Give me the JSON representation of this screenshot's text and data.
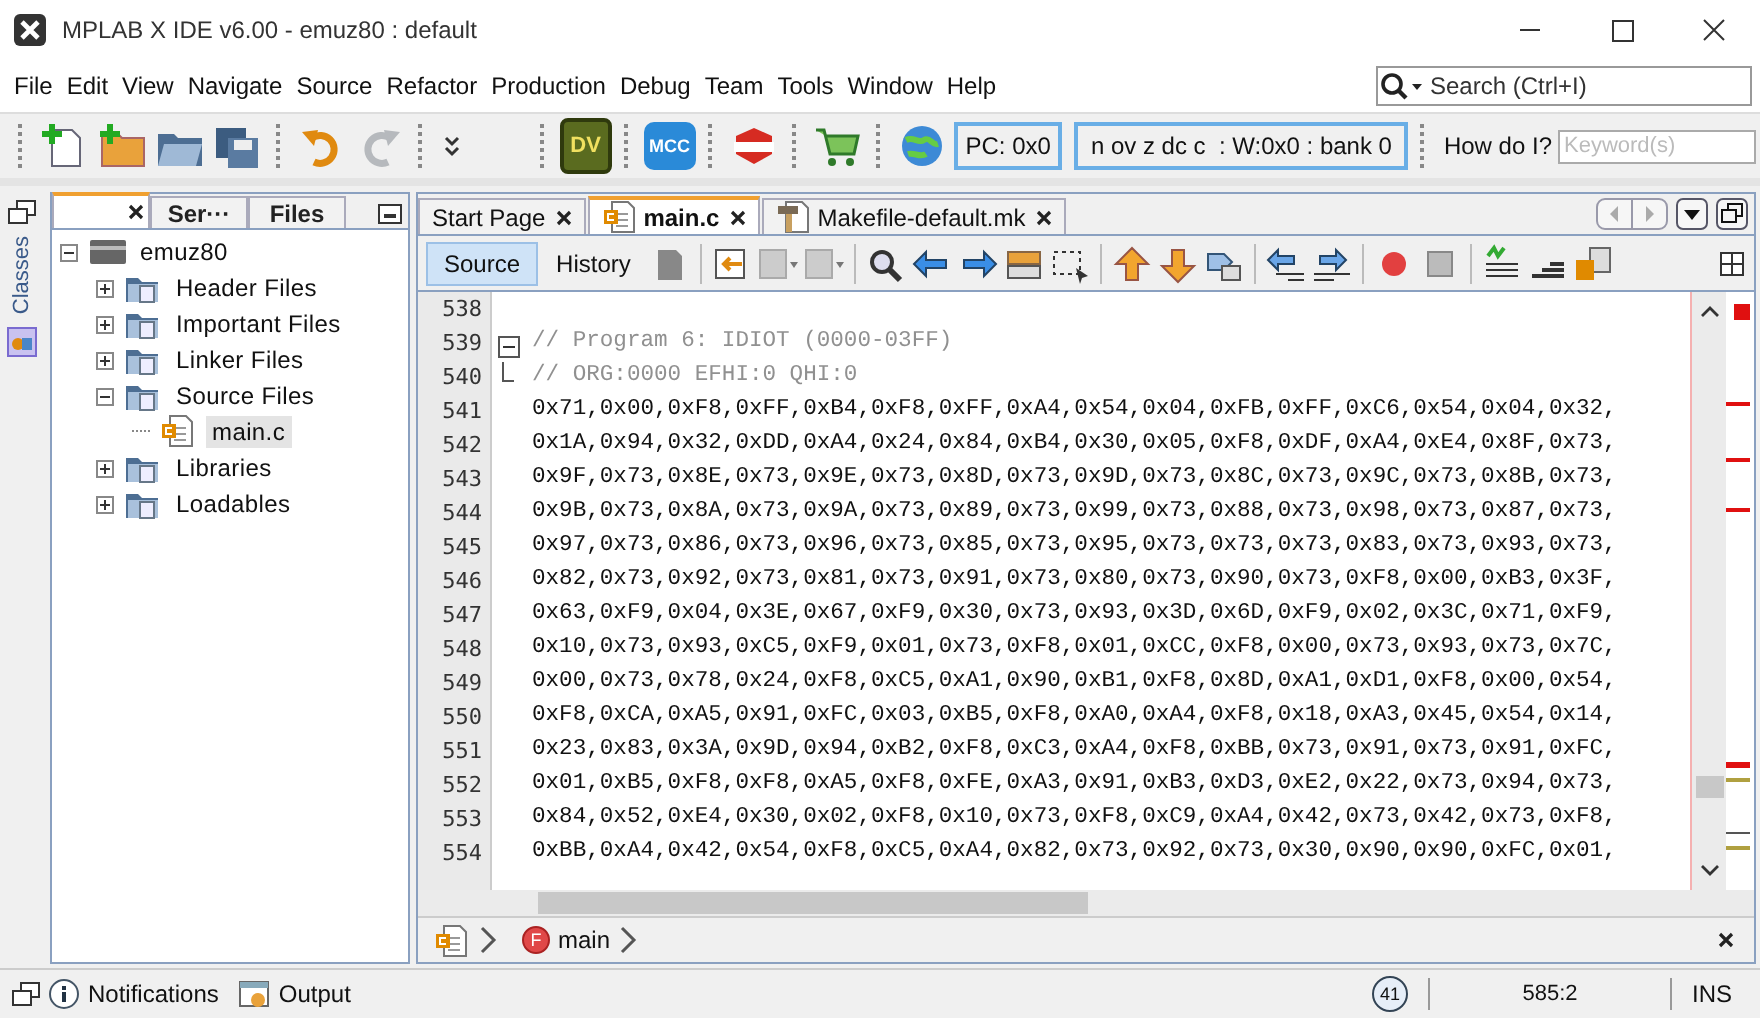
{
  "window": {
    "title": "MPLAB X IDE v6.00 - emuz80 : default"
  },
  "menu": [
    "File",
    "Edit",
    "View",
    "Navigate",
    "Source",
    "Refactor",
    "Production",
    "Debug",
    "Team",
    "Tools",
    "Window",
    "Help"
  ],
  "search": {
    "placeholder": "Search (Ctrl+I)"
  },
  "toolbar": {
    "logos": [
      {
        "kind": "dv",
        "label": "DV"
      },
      {
        "kind": "mcc",
        "label": "MCC"
      }
    ],
    "pc": "PC: 0x0",
    "status": "n ov z dc c  : W:0x0 : bank 0",
    "help_label": "How do I?",
    "keyword": {
      "placeholder": "Keyword(s)"
    }
  },
  "side_strip": {
    "label": "Classes"
  },
  "left_panel": {
    "tabs": [
      {
        "selected": true
      },
      {
        "label": "Ser···",
        "selected": false
      },
      {
        "label": "Files",
        "selected": false
      }
    ],
    "tree": [
      {
        "label": "emuz80",
        "kind": "project",
        "expanded": true,
        "selected": false,
        "children": [
          {
            "label": "Header Files",
            "kind": "folder",
            "expanded": false,
            "selected": false
          },
          {
            "label": "Important Files",
            "kind": "folder",
            "expanded": false,
            "selected": false
          },
          {
            "label": "Linker Files",
            "kind": "folder",
            "expanded": false,
            "selected": false
          },
          {
            "label": "Source Files",
            "kind": "folder",
            "expanded": true,
            "selected": false,
            "children": [
              {
                "label": "main.c",
                "kind": "file",
                "selected": true
              }
            ]
          },
          {
            "label": "Libraries",
            "kind": "folder",
            "expanded": false,
            "selected": false
          },
          {
            "label": "Loadables",
            "kind": "folder",
            "expanded": false,
            "selected": false
          }
        ]
      }
    ]
  },
  "editor": {
    "tabs": [
      {
        "label": "Start Page",
        "kind": "page",
        "selected": false
      },
      {
        "label": "main.c",
        "kind": "c",
        "selected": true
      },
      {
        "label": "Makefile-default.mk",
        "kind": "make",
        "selected": false
      }
    ],
    "views": [
      {
        "label": "Source",
        "selected": true
      },
      {
        "label": "History",
        "selected": false
      }
    ],
    "lines": [
      {
        "number": "538",
        "kind": "blank"
      },
      {
        "number": "539",
        "kind": "comment",
        "folded": false,
        "text": "// Program 6: IDIOT (0000-03FF)"
      },
      {
        "number": "540",
        "kind": "comment",
        "fold_end": true,
        "text": "// ORG:0000 EFHI:0 QHI:0"
      },
      {
        "number": "541",
        "kind": "code",
        "text": "0x71,0x00,0xF8,0xFF,0xB4,0xF8,0xFF,0xA4,0x54,0x04,0xFB,0xFF,0xC6,0x54,0x04,0x32,"
      },
      {
        "number": "542",
        "kind": "code",
        "text": "0x1A,0x94,0x32,0xDD,0xA4,0x24,0x84,0xB4,0x30,0x05,0xF8,0xDF,0xA4,0xE4,0x8F,0x73,"
      },
      {
        "number": "543",
        "kind": "code",
        "text": "0x9F,0x73,0x8E,0x73,0x9E,0x73,0x8D,0x73,0x9D,0x73,0x8C,0x73,0x9C,0x73,0x8B,0x73,"
      },
      {
        "number": "544",
        "kind": "code",
        "text": "0x9B,0x73,0x8A,0x73,0x9A,0x73,0x89,0x73,0x99,0x73,0x88,0x73,0x98,0x73,0x87,0x73,"
      },
      {
        "number": "545",
        "kind": "code",
        "text": "0x97,0x73,0x86,0x73,0x96,0x73,0x85,0x73,0x95,0x73,0x73,0x73,0x83,0x73,0x93,0x73,"
      },
      {
        "number": "546",
        "kind": "code",
        "text": "0x82,0x73,0x92,0x73,0x81,0x73,0x91,0x73,0x80,0x73,0x90,0x73,0xF8,0x00,0xB3,0x3F,"
      },
      {
        "number": "547",
        "kind": "code",
        "text": "0x63,0xF9,0x04,0x3E,0x67,0xF9,0x30,0x73,0x93,0x3D,0x6D,0xF9,0x02,0x3C,0x71,0xF9,"
      },
      {
        "number": "548",
        "kind": "code",
        "text": "0x10,0x73,0x93,0xC5,0xF9,0x01,0x73,0xF8,0x01,0xCC,0xF8,0x00,0x73,0x93,0x73,0x7C,"
      },
      {
        "number": "549",
        "kind": "code",
        "text": "0x00,0x73,0x78,0x24,0xF8,0xC5,0xA1,0x90,0xB1,0xF8,0x8D,0xA1,0xD1,0xF8,0x00,0x54,"
      },
      {
        "number": "550",
        "kind": "code",
        "text": "0xF8,0xCA,0xA5,0x91,0xFC,0x03,0xB5,0xF8,0xA0,0xA4,0xF8,0x18,0xA3,0x45,0x54,0x14,"
      },
      {
        "number": "551",
        "kind": "code",
        "text": "0x23,0x83,0x3A,0x9D,0x94,0xB2,0xF8,0xC3,0xA4,0xF8,0xBB,0x73,0x91,0x73,0x91,0xFC,"
      },
      {
        "number": "552",
        "kind": "code",
        "text": "0x01,0xB5,0xF8,0xF8,0xA5,0xF8,0xFE,0xA3,0x91,0xB3,0xD3,0xE2,0x22,0x73,0x94,0x73,"
      },
      {
        "number": "553",
        "kind": "code",
        "text": "0x84,0x52,0xE4,0x30,0x02,0xF8,0x10,0x73,0xF8,0xC9,0xA4,0x42,0x73,0x42,0x73,0xF8,"
      },
      {
        "number": "554",
        "kind": "code",
        "text": "0xBB,0xA4,0x42,0x54,0xF8,0xC5,0xA4,0x82,0x73,0x92,0x73,0x30,0x90,0x90,0xFC,0x01,"
      }
    ],
    "breadcrumb": {
      "badge": "F",
      "label": "main"
    }
  },
  "status_bar": {
    "items": [
      {
        "kind": "info",
        "label": "Notifications"
      },
      {
        "kind": "output",
        "label": "Output"
      }
    ],
    "count": "41",
    "position": "585:2",
    "mode": "INS"
  }
}
